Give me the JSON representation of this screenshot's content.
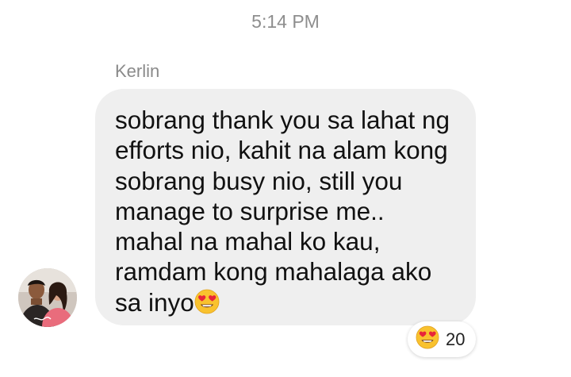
{
  "conversation": {
    "timestamp": "5:14 PM",
    "message": {
      "sender_name": "Kerlin",
      "text": "sobrang thank you sa lahat ng\nefforts nio, kahit na alam kong\nsobrang busy nio, still you\nmanage to surprise me..\nmahal na mahal ko kau,\nramdam kong mahalaga ako\nsa inyo",
      "trailing_icon": "heart-eyes-emoji",
      "bubble_color": "#efefef",
      "reaction": {
        "icon": "heart-eyes-emoji",
        "count": "20"
      },
      "avatar_icon": "profile-photo"
    }
  }
}
